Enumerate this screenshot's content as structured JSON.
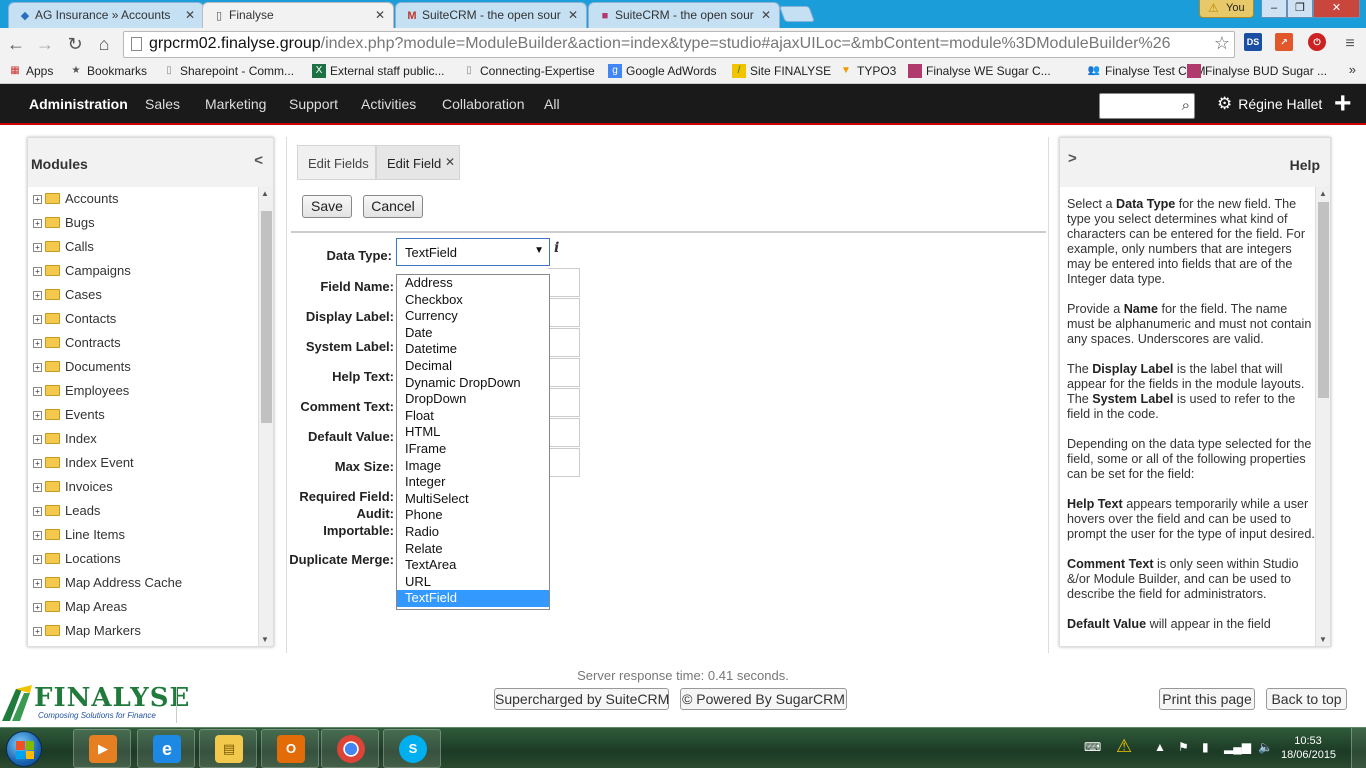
{
  "browser": {
    "tabs": [
      {
        "title": "AG Insurance » Accounts",
        "icon": "ag-favicon"
      },
      {
        "title": "Finalyse",
        "icon": "page-favicon"
      },
      {
        "title": "SuiteCRM - the open sour",
        "icon": "gmail-favicon"
      },
      {
        "title": "SuiteCRM - the open sour",
        "icon": "suitecrm-favicon"
      }
    ],
    "window_user": "You",
    "url_host": "grpcrm02.finalyse.group",
    "url_path": "/index.php?module=ModuleBuilder&action=index&type=studio#ajaxUILoc=&mbContent=module%3DModuleBuilder%26",
    "bookmarks": [
      {
        "label": "Apps",
        "icon": "apps-grid-icon"
      },
      {
        "label": "Bookmarks",
        "icon": "star-icon"
      },
      {
        "label": "Sharepoint - Comm...",
        "icon": "page-icon"
      },
      {
        "label": "External staff public...",
        "icon": "excel-icon"
      },
      {
        "label": "Connecting-Expertise",
        "icon": "page-icon"
      },
      {
        "label": "Google AdWords",
        "icon": "google-icon"
      },
      {
        "label": "Site FINALYSE",
        "icon": "finalyse-icon"
      },
      {
        "label": "TYPO3",
        "icon": "typo3-icon"
      },
      {
        "label": "Finalyse WE Sugar C...",
        "icon": "suitecrm-icon"
      },
      {
        "label": "Finalyse Test CRM",
        "icon": "people-icon"
      },
      {
        "label": "Finalyse BUD Sugar ...",
        "icon": "suitecrm-icon"
      }
    ],
    "bookmarks_more": "»"
  },
  "nav": {
    "items": [
      "Administration",
      "Sales",
      "Marketing",
      "Support",
      "Activities",
      "Collaboration",
      "All"
    ],
    "user_name": "Régine Hallet"
  },
  "modules_panel": {
    "title": "Modules",
    "collapse_glyph": "<",
    "items": [
      "Accounts",
      "Bugs",
      "Calls",
      "Campaigns",
      "Cases",
      "Contacts",
      "Contracts",
      "Documents",
      "Employees",
      "Events",
      "Index",
      "Index Event",
      "Invoices",
      "Leads",
      "Line Items",
      "Locations",
      "Map Address Cache",
      "Map Areas",
      "Map Markers"
    ]
  },
  "editor": {
    "tabs": [
      "Edit Fields",
      "Edit Field"
    ],
    "save_label": "Save",
    "cancel_label": "Cancel",
    "labels": {
      "data_type": "Data Type:",
      "field_name": "Field Name:",
      "display_label": "Display Label:",
      "system_label": "System Label:",
      "help_text": "Help Text:",
      "comment_text": "Comment Text:",
      "default_value": "Default Value:",
      "max_size": "Max Size:",
      "required_field": "Required Field:",
      "audit": "Audit:",
      "importable": "Importable:",
      "duplicate_merge": "Duplicate Merge:"
    },
    "data_type_value": "TextField",
    "data_type_options": [
      "Address",
      "Checkbox",
      "Currency",
      "Date",
      "Datetime",
      "Decimal",
      "Dynamic DropDown",
      "DropDown",
      "Float",
      "HTML",
      "IFrame",
      "Image",
      "Integer",
      "MultiSelect",
      "Phone",
      "Radio",
      "Relate",
      "TextArea",
      "URL",
      "TextField"
    ],
    "selected_option": "TextField"
  },
  "help_panel": {
    "title": "Help",
    "expand_glyph": ">",
    "p1_a": "Select a ",
    "p1_b": "Data Type",
    "p1_c": " for the new field. The type you select determines what kind of characters can be entered for the field. For example, only numbers that are integers may be entered into fields that are of the Integer data type.",
    "p2_a": "Provide a ",
    "p2_b": "Name",
    "p2_c": " for the field. The name must be alphanumeric and must not contain any spaces. Underscores are valid.",
    "p3_a": "The ",
    "p3_b": "Display Label",
    "p3_c": " is the label that will appear for the fields in the module layouts. The ",
    "p3_d": "System Label",
    "p3_e": " is used to refer to the field in the code.",
    "p4": "Depending on the data type selected for the field, some or all of the following properties can be set for the field:",
    "p5_b": "Help Text",
    "p5_c": " appears temporarily while a user hovers over the field and can be used to prompt the user for the type of input desired.",
    "p6_b": "Comment Text",
    "p6_c": " is only seen within Studio &/or Module Builder, and can be used to describe the field for administrators.",
    "p7_b": "Default Value",
    "p7_c": " will appear in the field"
  },
  "footer": {
    "server_time": "Server response time: 0.41 seconds.",
    "supercharged": "Supercharged by SuiteCRM",
    "powered": "© Powered By SugarCRM",
    "print": "Print this page",
    "back_to_top": "Back to top",
    "logo_text": "FINALYSE",
    "logo_tagline": "Composing Solutions for Finance"
  },
  "taskbar": {
    "apps": [
      "media-player-icon",
      "internet-explorer-icon",
      "file-explorer-icon",
      "outlook-icon",
      "chrome-icon",
      "skype-icon"
    ],
    "time": "10:53",
    "date": "18/06/2015"
  },
  "colors": {
    "nav_bg": "#1a1a1a",
    "nav_accent": "#cc0000",
    "select_highlight": "#3399ff",
    "logo_green": "#1f7a3c"
  }
}
